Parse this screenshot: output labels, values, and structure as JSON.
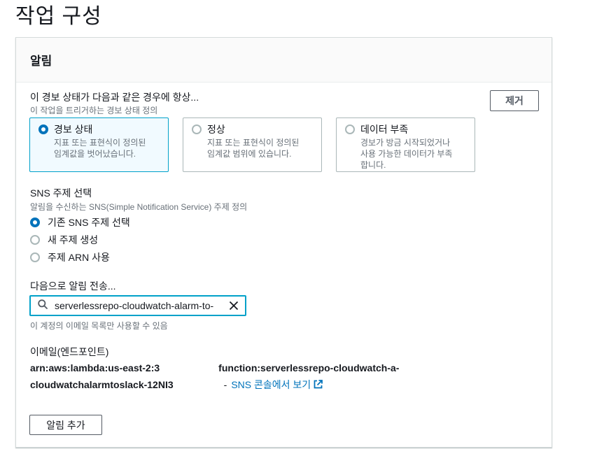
{
  "page": {
    "title": "작업 구성"
  },
  "panel": {
    "title": "알림",
    "state_label": "이 경보 상태가 다음과 같은 경우에 항상...",
    "state_desc": "이 작업을 트리거하는 경보 상태 정의",
    "remove_label": "제거",
    "tiles": [
      {
        "title": "경보 상태",
        "desc1": "지표 또는 표현식이 정의된",
        "desc2": "임계값을 벗어났습니다.",
        "desc3": "",
        "selected": true
      },
      {
        "title": "정상",
        "desc1": "지표 또는 표현식이 정의된",
        "desc2": "임계값 범위에 있습니다.",
        "desc3": "",
        "selected": false
      },
      {
        "title": "데이터 부족",
        "desc1": "경보가 방금 시작되었거나",
        "desc2": "사용 가능한 데이터가 부족",
        "desc3": "합니다.",
        "selected": false
      }
    ],
    "sns_label": "SNS 주제 선택",
    "sns_desc": "알림을 수신하는 SNS(Simple Notification Service) 주제 정의",
    "sns_options": [
      {
        "label": "기존 SNS 주제 선택",
        "selected": true
      },
      {
        "label": "새 주제 생성",
        "selected": false
      },
      {
        "label": "주제 ARN 사용",
        "selected": false
      }
    ],
    "send_label": "다음으로 알림 전송...",
    "search_value": "serverlessrepo-cloudwatch-alarm-to-",
    "search_hint": "이 계정의 이메일 목록만 사용할 수 있음",
    "email_label": "이메일(엔드포인트)",
    "arn_line1_a": "arn:aws:lambda:us-east-2:3",
    "arn_line1_b": "function:serverlessrepo-cloudwatch-a-",
    "arn_line2": "cloudwatchalarmtoslack-12NI3",
    "arn_line2_sep": "-",
    "sns_console_link": "SNS 콘솔에서 보기",
    "add_alarm_label": "알림 추가"
  },
  "colors": {
    "accent": "#0073bb",
    "focus": "#00a1c9"
  },
  "icons": {
    "search": "search-icon",
    "clear": "close-icon",
    "external": "external-link-icon"
  }
}
